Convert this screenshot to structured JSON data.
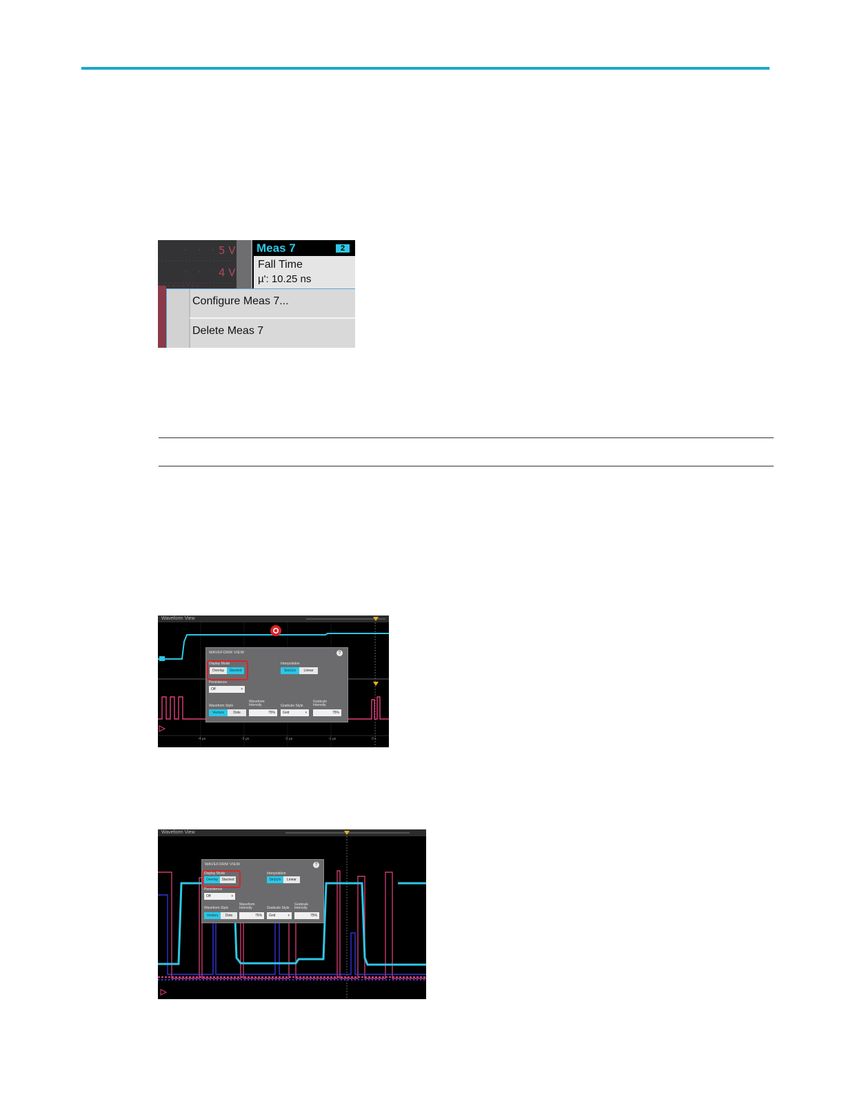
{
  "figure1": {
    "volt_labels": [
      "5 V",
      "4 V"
    ],
    "badge_title": "Meas 7",
    "badge_number": "2",
    "measurement_name": "Fall Time",
    "measurement_value": "µ': 10.25 ns",
    "menu": {
      "configure_label": "Configure Meas 7...",
      "delete_label": "Delete Meas 7"
    }
  },
  "figure2": {
    "window_title": "Waveform View",
    "dialog": {
      "title": "WAVEFORM VIEW",
      "help_glyph": "?",
      "display_mode_label": "Display Mode",
      "display_mode_options": [
        "Overlay",
        "Stacked"
      ],
      "display_mode_selected": "Stacked",
      "interpolation_label": "Interpolation",
      "interpolation_options": [
        "Sin(x)/x",
        "Linear"
      ],
      "interpolation_selected": "Sin(x)/x",
      "persistence_label": "Persistence",
      "persistence_value": "Off",
      "waveform_style_label": "Waveform Style",
      "waveform_style_options": [
        "Vectors",
        "Dots"
      ],
      "waveform_style_selected": "Vectors",
      "waveform_intensity_label": "Waveform Intensity",
      "waveform_intensity_value": "75%",
      "graticule_style_label": "Graticule Style",
      "graticule_style_value": "Grid",
      "graticule_intensity_label": "Graticule Intensity",
      "graticule_intensity_value": "75%"
    },
    "time_labels": [
      "-4 µs",
      "-3 µs",
      "-2 µs",
      "-1 µs",
      "0 s"
    ]
  },
  "figure3": {
    "window_title": "Waveform View",
    "dialog": {
      "title": "WAVEFORM VIEW",
      "help_glyph": "?",
      "display_mode_label": "Display Mode",
      "display_mode_options": [
        "Overlay",
        "Stacked"
      ],
      "display_mode_selected": "Overlay",
      "interpolation_label": "Interpolation",
      "interpolation_options": [
        "Sin(x)/x",
        "Linear"
      ],
      "interpolation_selected": "Sin(x)/x",
      "persistence_label": "Persistence",
      "persistence_value": "Off",
      "waveform_style_label": "Waveform Style",
      "waveform_style_options": [
        "Vectors",
        "Dots"
      ],
      "waveform_style_selected": "Vectors",
      "waveform_intensity_label": "Waveform Intensity",
      "waveform_intensity_value": "75%",
      "graticule_style_label": "Graticule Style",
      "graticule_style_value": "Grid",
      "graticule_intensity_label": "Graticule Intensity",
      "graticule_intensity_value": "75%"
    }
  },
  "colors": {
    "accent_rule": "#1ba8c9",
    "ch1_cyan": "#2ec7e6",
    "ch2_pink": "#e0407a",
    "ch3_blue": "#3a3af0",
    "highlight_red": "#d8232a"
  }
}
